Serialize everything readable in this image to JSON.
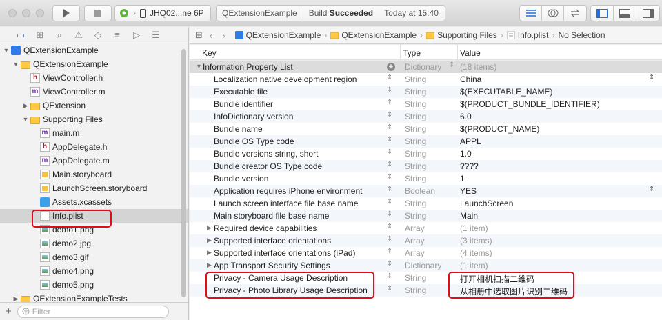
{
  "toolbar": {
    "scheme_name": "JHQ02...ne 6P",
    "status_project": "QExtensionExample",
    "status_build": "Build",
    "status_result": "Succeeded",
    "status_time": "Today at 15:40"
  },
  "navigator": {
    "filter_placeholder": "Filter",
    "items": [
      {
        "label": "QExtensionExample",
        "icon": "project-icon",
        "depth": 0,
        "disclosure": "open"
      },
      {
        "label": "QExtensionExample",
        "icon": "folder-icon",
        "depth": 1,
        "disclosure": "open"
      },
      {
        "label": "ViewController.h",
        "icon": "header-file-icon",
        "depth": 2,
        "disclosure": "none"
      },
      {
        "label": "ViewController.m",
        "icon": "implementation-file-icon",
        "depth": 2,
        "disclosure": "none"
      },
      {
        "label": "QExtension",
        "icon": "folder-icon",
        "depth": 2,
        "disclosure": "closed"
      },
      {
        "label": "Supporting Files",
        "icon": "folder-icon",
        "depth": 2,
        "disclosure": "open"
      },
      {
        "label": "main.m",
        "icon": "implementation-file-icon",
        "depth": 3,
        "disclosure": "none"
      },
      {
        "label": "AppDelegate.h",
        "icon": "header-file-icon",
        "depth": 3,
        "disclosure": "none"
      },
      {
        "label": "AppDelegate.m",
        "icon": "implementation-file-icon",
        "depth": 3,
        "disclosure": "none"
      },
      {
        "label": "Main.storyboard",
        "icon": "storyboard-icon",
        "depth": 3,
        "disclosure": "none"
      },
      {
        "label": "LaunchScreen.storyboard",
        "icon": "storyboard-icon",
        "depth": 3,
        "disclosure": "none"
      },
      {
        "label": "Assets.xcassets",
        "icon": "asset-catalog-icon",
        "depth": 3,
        "disclosure": "none"
      },
      {
        "label": "Info.plist",
        "icon": "plist-file-icon",
        "depth": 3,
        "disclosure": "none",
        "selected": true
      },
      {
        "label": "demo1.png",
        "icon": "image-file-icon",
        "depth": 3,
        "disclosure": "none"
      },
      {
        "label": "demo2.jpg",
        "icon": "image-file-icon",
        "depth": 3,
        "disclosure": "none"
      },
      {
        "label": "demo3.gif",
        "icon": "image-file-icon",
        "depth": 3,
        "disclosure": "none"
      },
      {
        "label": "demo4.png",
        "icon": "image-file-icon",
        "depth": 3,
        "disclosure": "none"
      },
      {
        "label": "demo5.png",
        "icon": "image-file-icon",
        "depth": 3,
        "disclosure": "none"
      },
      {
        "label": "QExtensionExampleTests",
        "icon": "folder-icon",
        "depth": 1,
        "disclosure": "closed"
      }
    ]
  },
  "jumpbar": {
    "crumbs": [
      "QExtensionExample",
      "QExtensionExample",
      "Supporting Files",
      "Info.plist",
      "No Selection"
    ]
  },
  "plist": {
    "headers": {
      "key": "Key",
      "type": "Type",
      "value": "Value"
    },
    "rows": [
      {
        "key": "Information Property List",
        "type": "Dictionary",
        "value": "(18 items)",
        "level": 0,
        "disclosure": "open",
        "root": true
      },
      {
        "key": "Localization native development region",
        "type": "String",
        "value": "China",
        "level": 1,
        "dropdown": true
      },
      {
        "key": "Executable file",
        "type": "String",
        "value": "$(EXECUTABLE_NAME)",
        "level": 1
      },
      {
        "key": "Bundle identifier",
        "type": "String",
        "value": "$(PRODUCT_BUNDLE_IDENTIFIER)",
        "level": 1
      },
      {
        "key": "InfoDictionary version",
        "type": "String",
        "value": "6.0",
        "level": 1
      },
      {
        "key": "Bundle name",
        "type": "String",
        "value": "$(PRODUCT_NAME)",
        "level": 1
      },
      {
        "key": "Bundle OS Type code",
        "type": "String",
        "value": "APPL",
        "level": 1
      },
      {
        "key": "Bundle versions string, short",
        "type": "String",
        "value": "1.0",
        "level": 1
      },
      {
        "key": "Bundle creator OS Type code",
        "type": "String",
        "value": "????",
        "level": 1
      },
      {
        "key": "Bundle version",
        "type": "String",
        "value": "1",
        "level": 1
      },
      {
        "key": "Application requires iPhone environment",
        "type": "Boolean",
        "value": "YES",
        "level": 1,
        "dropdown": true
      },
      {
        "key": "Launch screen interface file base name",
        "type": "String",
        "value": "LaunchScreen",
        "level": 1
      },
      {
        "key": "Main storyboard file base name",
        "type": "String",
        "value": "Main",
        "level": 1
      },
      {
        "key": "Required device capabilities",
        "type": "Array",
        "value": "(1 item)",
        "level": 1,
        "disclosure": "closed",
        "gray": true
      },
      {
        "key": "Supported interface orientations",
        "type": "Array",
        "value": "(3 items)",
        "level": 1,
        "disclosure": "closed",
        "gray": true
      },
      {
        "key": "Supported interface orientations (iPad)",
        "type": "Array",
        "value": "(4 items)",
        "level": 1,
        "disclosure": "closed",
        "gray": true
      },
      {
        "key": "App Transport Security Settings",
        "type": "Dictionary",
        "value": "(1 item)",
        "level": 1,
        "disclosure": "closed",
        "gray": true
      },
      {
        "key": "Privacy - Camera Usage Description",
        "type": "String",
        "value": "打开相机扫描二维码",
        "level": 1
      },
      {
        "key": "Privacy - Photo Library Usage Description",
        "type": "String",
        "value": "从相册中选取图片识别二维码",
        "level": 1
      }
    ]
  },
  "colors": {
    "accent": "#1f6fe0",
    "highlight": "#e30b1b",
    "selected_row": "#d4d4d4"
  }
}
